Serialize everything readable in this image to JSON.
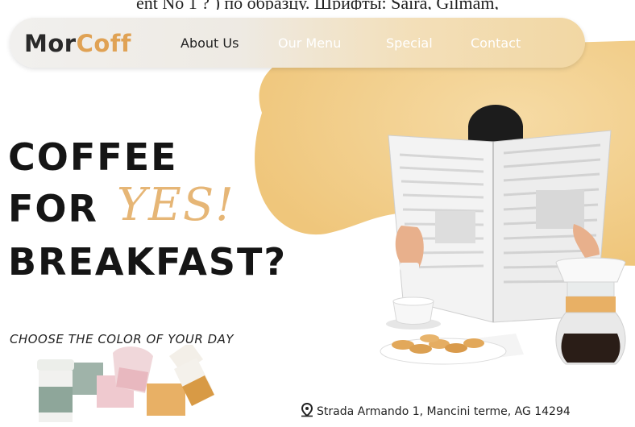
{
  "page_caption": {
    "text": "ent No 1 ? ) по образцу. ",
    "underlined": "Шрифты: Saira, Gilmam,"
  },
  "brand": {
    "logo_part1": "Mor",
    "logo_part2": "Coff",
    "accent_color": "#e0a254"
  },
  "nav": {
    "items": [
      {
        "label": "About Us"
      },
      {
        "label": "Our Menu"
      },
      {
        "label": "Special"
      },
      {
        "label": "Contact"
      }
    ]
  },
  "hero": {
    "line1": "COFFEE",
    "line2": "FOR",
    "highlight": "YES!",
    "line3": "BREAKFAST?",
    "tagline": "CHOOSE THE COLOR OF YOUR DAY"
  },
  "footer": {
    "address": "Strada Armando 1, Mancini terme, AG 14294",
    "address_icon": "map-pin-icon"
  },
  "colors": {
    "blob": "#f3cf8d",
    "dark_text": "#151515",
    "highlight": "#e6b676"
  }
}
